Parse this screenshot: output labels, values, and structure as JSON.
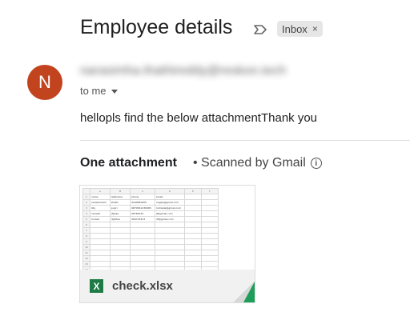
{
  "email": {
    "subject": "Employee details",
    "label": "Inbox",
    "label_close": "×",
    "avatar_letter": "N",
    "sender": "narasimha.thathireddy@reskon.tech",
    "recipient_text": "to me",
    "body": "hellopls find the below attachmentThank you"
  },
  "attachments": {
    "heading": "One attachment",
    "scanned": "• Scanned by Gmail",
    "info_glyph": "i",
    "file": {
      "name": "check.xlsx",
      "icon_letter": "X",
      "preview": {
        "columns": [
          "A",
          "B",
          "C",
          "D",
          "E",
          "F"
        ],
        "header": [
          "name",
          "lastname",
          "phone",
          "email",
          "",
          ""
        ],
        "rows": [
          [
            "narasimham",
            "thathi",
            "9440830955",
            "nagaa@gmail.com",
            "",
            ""
          ],
          [
            "lilly",
            "pujiri",
            "9874561230965",
            "lcollabia@gmail.com",
            "",
            ""
          ],
          [
            "ramesh",
            "jfghse",
            "98765432",
            "jf@gmail.com",
            "",
            ""
          ],
          [
            "mohan",
            "dgfrtve",
            "456723413",
            "df@gmail.com",
            "",
            ""
          ]
        ]
      }
    }
  },
  "colors": {
    "avatar": "#c1441e",
    "excel_green": "#1e7b45"
  }
}
